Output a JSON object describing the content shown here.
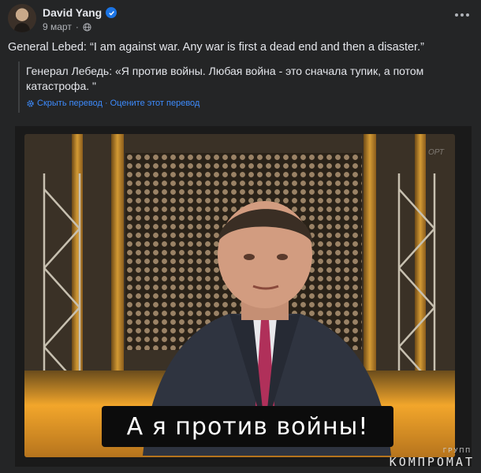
{
  "post": {
    "author": "David Yang",
    "date": "9 март",
    "text": "General Lebed: “I am against war.  Any war is first a dead end and then a disaster.”"
  },
  "translation": {
    "text": "Генерал Лебедь: «Я против войны. Любая война - это сначала тупик, а потом катастрофа. \"",
    "hide_link": "Скрыть перевод",
    "separator": "·",
    "rate_link": "Оцените этот перевод"
  },
  "video": {
    "subtitle": "А я против войны!",
    "corner_watermark": "ОРТ"
  },
  "watermark": {
    "small": "ГРУПП",
    "main": "КОМПРОМАТ"
  },
  "colors": {
    "background": "#242526",
    "link": "#3d8bfd",
    "verified": "#1b74e4"
  }
}
